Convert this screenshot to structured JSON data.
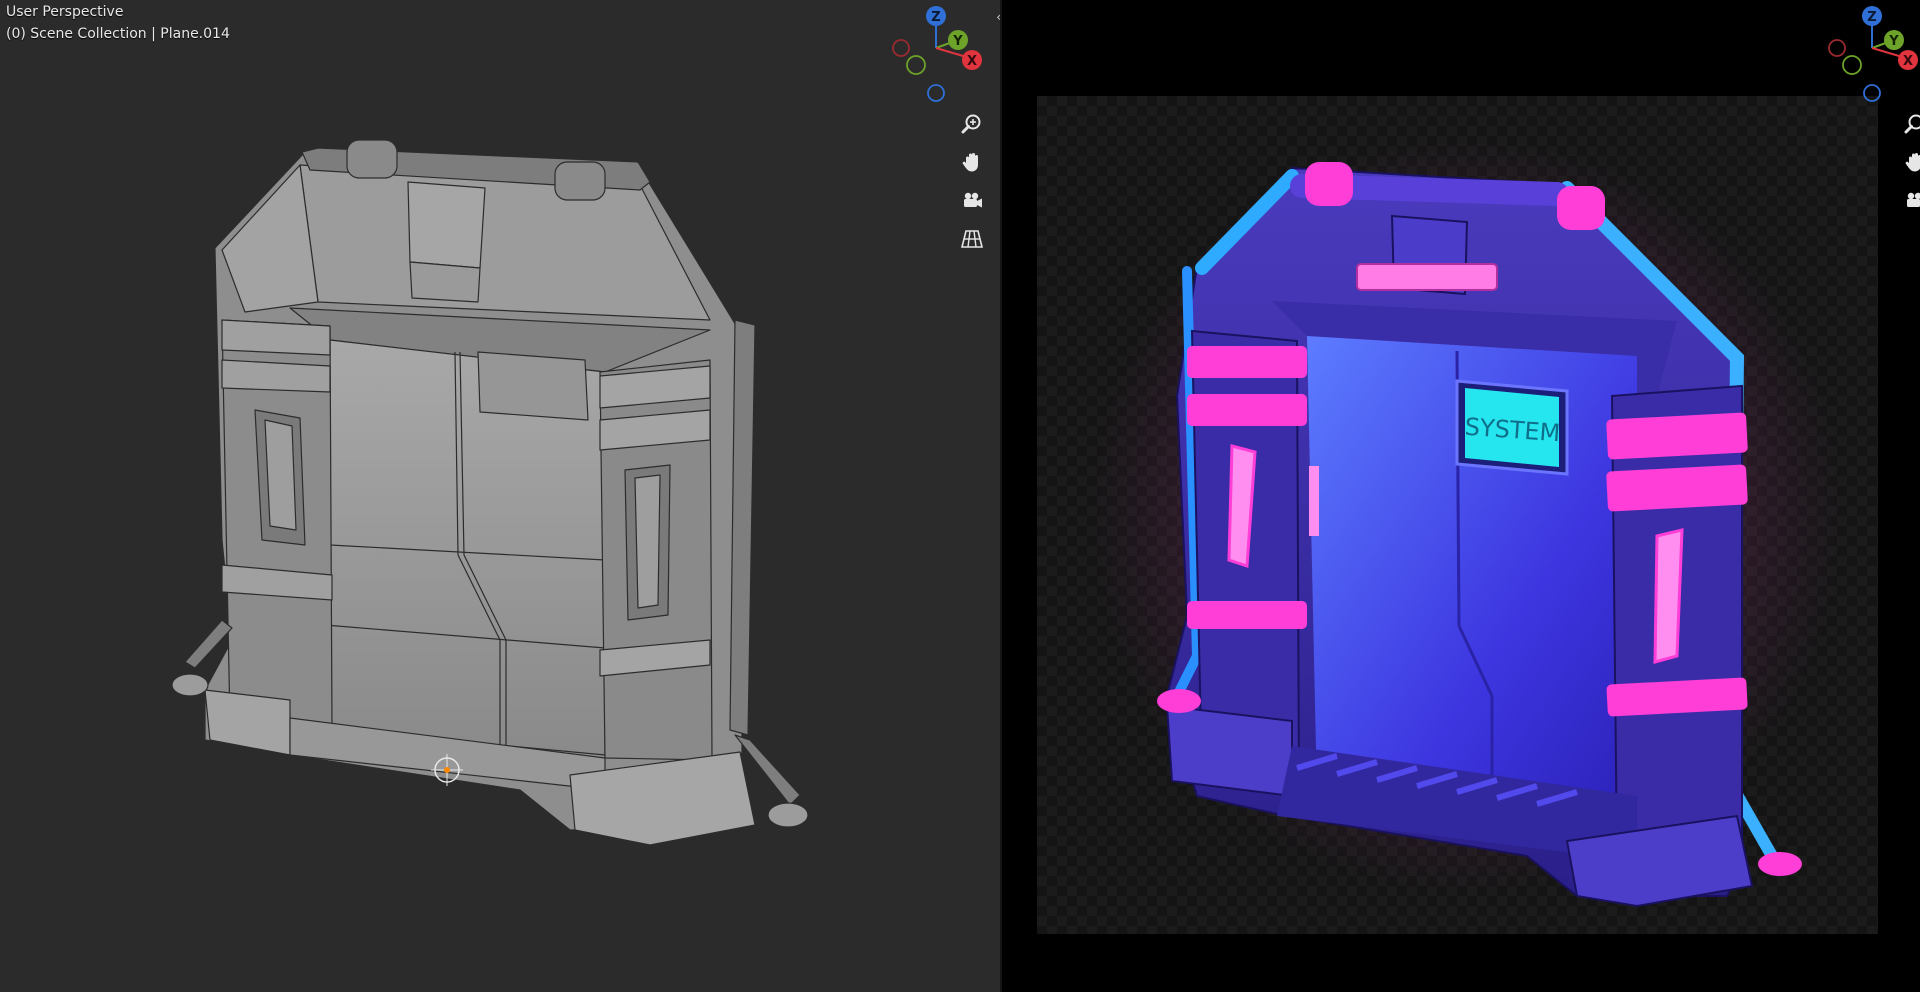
{
  "viewport_left": {
    "title": "User Perspective",
    "subtitle": "(0) Scene Collection | Plane.014",
    "gizmo": {
      "z_label": "Z",
      "y_label": "Y",
      "x_label": "X"
    },
    "nav_buttons": [
      {
        "icon": "zoom-icon"
      },
      {
        "icon": "hand-pan-icon"
      },
      {
        "icon": "camera-icon"
      },
      {
        "icon": "grid-icon"
      }
    ],
    "model": "grey mesh sci-fi doorway"
  },
  "splitter": {
    "arrows": "‹›"
  },
  "viewport_right": {
    "gizmo": {
      "z_label": "Z",
      "y_label": "Y",
      "x_label": "X"
    },
    "reference_image": {
      "door_screen_text": "SYSTEM"
    }
  },
  "colors": {
    "axis_x": "#e0343f",
    "axis_y": "#6ea32a",
    "axis_z": "#2f6fd6",
    "viewport_bg": "#2b2b2b",
    "neon_magenta": "#ff3dd7",
    "neon_cyan": "#25e6ef"
  }
}
